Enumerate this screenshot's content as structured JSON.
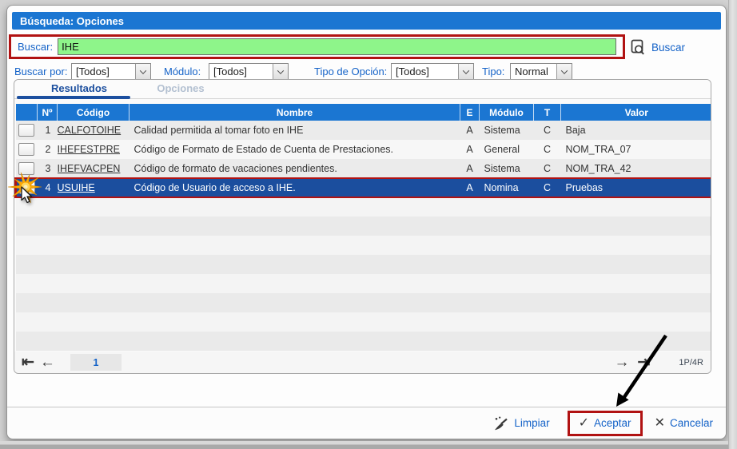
{
  "window": {
    "title": "Búsqueda: Opciones"
  },
  "search": {
    "label": "Buscar:",
    "value": "IHE",
    "button_label": "Buscar"
  },
  "filters": {
    "buscar_por": {
      "label": "Buscar por:",
      "value": "[Todos]"
    },
    "modulo": {
      "label": "Módulo:",
      "value": "[Todos]"
    },
    "tipo_opcion": {
      "label": "Tipo de Opción:",
      "value": "[Todos]"
    },
    "tipo": {
      "label": "Tipo:",
      "value": "Normal"
    }
  },
  "tabs": {
    "resultados": "Resultados",
    "opciones": "Opciones"
  },
  "table": {
    "columns": [
      "",
      "Nº",
      "Código",
      "Nombre",
      "E",
      "Módulo",
      "T",
      "Valor"
    ],
    "rows": [
      {
        "n": "1",
        "codigo": "CALFOTOIHE",
        "nombre": "Calidad permitida al tomar foto en IHE",
        "e": "A",
        "modulo": "Sistema",
        "t": "C",
        "valor": "Baja",
        "selected": false
      },
      {
        "n": "2",
        "codigo": "IHEFESTPRE",
        "nombre": "Código de Formato de Estado de Cuenta de Prestaciones.",
        "e": "A",
        "modulo": "General",
        "t": "C",
        "valor": "NOM_TRA_07",
        "selected": false
      },
      {
        "n": "3",
        "codigo": "IHEFVACPEN",
        "nombre": "Código de formato de vacaciones pendientes.",
        "e": "A",
        "modulo": "Sistema",
        "t": "C",
        "valor": "NOM_TRA_42",
        "selected": false
      },
      {
        "n": "4",
        "codigo": "USUIHE",
        "nombre": "Código de Usuario de acceso a IHE.",
        "e": "A",
        "modulo": "Nomina",
        "t": "C",
        "valor": "Pruebas",
        "selected": true
      }
    ]
  },
  "pagination": {
    "first_icon": "⇤",
    "prev_icon": "←",
    "page": "1",
    "next_icon": "→",
    "last_icon": "⇥",
    "summary": "1P/4R"
  },
  "footer": {
    "limpiar": "Limpiar",
    "aceptar": "Aceptar",
    "cancelar": "Cancelar",
    "check_icon": "✓",
    "cancel_icon": "✕"
  },
  "colors": {
    "titlebar_blue": "#1b76d2",
    "table_header_blue": "#1b76d2",
    "selected_row_blue": "#1b4e9e",
    "annotation_red": "#b11212",
    "search_input_green": "#8ef58a",
    "link_blue": "#1563c8"
  }
}
